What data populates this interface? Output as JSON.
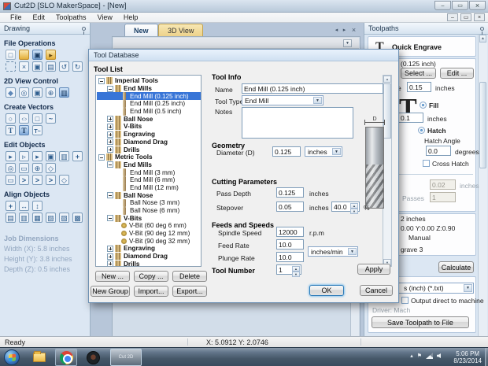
{
  "window": {
    "title": "Cut2D [SLO MakerSpace] - [New]"
  },
  "menu": [
    "File",
    "Edit",
    "Toolpaths",
    "View",
    "Help"
  ],
  "drawing": {
    "title": "Drawing",
    "file_operations": "File Operations",
    "view_control": "2D View Control",
    "create_vectors": "Create Vectors",
    "edit_objects": "Edit Objects",
    "align_objects": "Align Objects",
    "job": {
      "title": "Job Dimensions",
      "width": "Width (X): 5.8 inches",
      "height": "Height (Y): 3.8 inches",
      "depth": "Depth (Z): 0.5 inches"
    }
  },
  "tabs": {
    "new": "New",
    "view3d": "3D View"
  },
  "toolpaths": {
    "title": "Toolpaths",
    "quick_engrave": "Quick Engrave",
    "tool_fragment": "(0.125 inch)",
    "select": "Select ...",
    "edit": "Edit ...",
    "depth_label_fragment": "e",
    "depth_value": "0.15",
    "depth_units": "inches",
    "fill": "Fill",
    "fill_stepover_value": "0.1",
    "fill_stepover_units": "inches",
    "hatch": "Hatch",
    "hatch_angle": "Hatch Angle",
    "hatch_angle_value": "0.0",
    "hatch_angle_units": "degrees",
    "cross_hatch": "Cross Hatch",
    "pass_depth_value": "0.02",
    "pass_depth_units": "inches",
    "passes": "Passes",
    "passes_value": "1",
    "size_fragment": "2 inches",
    "home_fragment": "0.00 Y:0.00 Z:0.90",
    "home_mode": "Manual",
    "name_fragment": "grave 3",
    "calculate": "Calculate",
    "post_fragment": "s (inch) (*.txt)",
    "output_direct": "Output direct to machine",
    "driver": "Driver: Mach",
    "save": "Save Toolpath to File"
  },
  "dialog": {
    "title": "Tool Database",
    "tool_list": "Tool List",
    "tree": [
      "Imperial Tools",
      "End Mills",
      "End Mill (0.125 inch)",
      "End Mill (0.25 inch)",
      "End Mill (0.5 inch)",
      "Ball Nose",
      "V-Bits",
      "Engraving",
      "Diamond Drag",
      "Drills",
      "Metric Tools",
      "End Mills",
      "End Mill (3 mm)",
      "End Mill (6 mm)",
      "End Mill (12 mm)",
      "Ball Nose",
      "Ball Nose (3 mm)",
      "Ball Nose (6 mm)",
      "V-Bits",
      "V-Bit (60 deg 6 mm)",
      "V-Bit (90 deg 12 mm)",
      "V-Bit (90 deg 32 mm)",
      "Engraving",
      "Diamond Drag",
      "Drills"
    ],
    "new": "New ...",
    "copy": "Copy ...",
    "delete": "Delete",
    "new_group": "New Group",
    "import": "Import...",
    "export": "Export...",
    "info": {
      "heading": "Tool Info",
      "name": "Name",
      "name_value": "End Mill (0.125 inch)",
      "type": "Tool Type",
      "type_value": "End Mill",
      "notes": "Notes",
      "geometry": "Geometry",
      "diameter": "Diameter (D)",
      "diameter_value": "0.125",
      "diameter_units": "inches",
      "d": "D",
      "cutting": "Cutting Parameters",
      "pass_depth": "Pass Depth",
      "pass_depth_value": "0.125",
      "pass_depth_units": "inches",
      "stepover": "Stepover",
      "stepover_value": "0.05",
      "stepover_units": "inches",
      "stepover_pct": "40.0",
      "pct": "%",
      "feeds": "Feeds and Speeds",
      "spindle": "Spindle Speed",
      "spindle_value": "12000",
      "spindle_units": "r.p.m",
      "feed": "Feed Rate",
      "feed_value": "10.0",
      "plunge": "Plunge Rate",
      "plunge_value": "10.0",
      "rate_units": "inches/min",
      "tool_number": "Tool Number",
      "tool_number_value": "1"
    },
    "apply": "Apply",
    "ok": "OK",
    "cancel": "Cancel"
  },
  "status": {
    "ready": "Ready",
    "coords": "X: 5.0912 Y: 2.0746"
  },
  "taskbar": {
    "app": "Cut 2D",
    "time": "5:06 PM",
    "date": "8/23/2014"
  }
}
